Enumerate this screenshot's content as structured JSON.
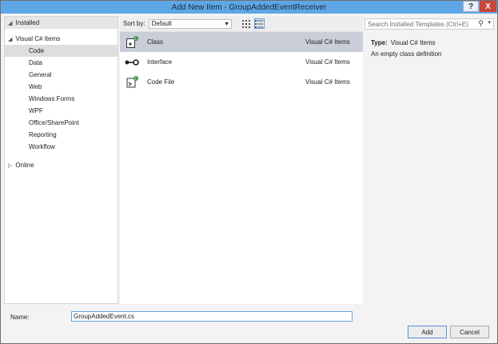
{
  "window": {
    "title": "Add New Item - GroupAddedEventReceiver",
    "help_label": "?",
    "close_label": "X"
  },
  "left_pane": {
    "installed_label": "Installed",
    "parent_label": "Visual C# Items",
    "categories": [
      "Code",
      "Data",
      "General",
      "Web",
      "Windows Forms",
      "WPF",
      "Office/SharePoint",
      "Reporting",
      "Workflow"
    ],
    "online_label": "Online"
  },
  "toolbar": {
    "sort_by_label": "Sort by:",
    "sort_value": "Default"
  },
  "templates": [
    {
      "name": "Class",
      "language": "Visual C# Items",
      "icon": "class-icon"
    },
    {
      "name": "Interface",
      "language": "Visual C# Items",
      "icon": "interface-icon"
    },
    {
      "name": "Code File",
      "language": "Visual C# Items",
      "icon": "code-file-icon"
    }
  ],
  "search": {
    "placeholder": "Search Installed Templates (Ctrl+E)"
  },
  "details": {
    "type_label": "Type:",
    "type_value": "Visual C# Items",
    "description": "An empty class definition"
  },
  "bottom": {
    "name_label": "Name:",
    "name_value": "GroupAddedEvent.cs",
    "add_label": "Add",
    "cancel_label": "Cancel"
  }
}
